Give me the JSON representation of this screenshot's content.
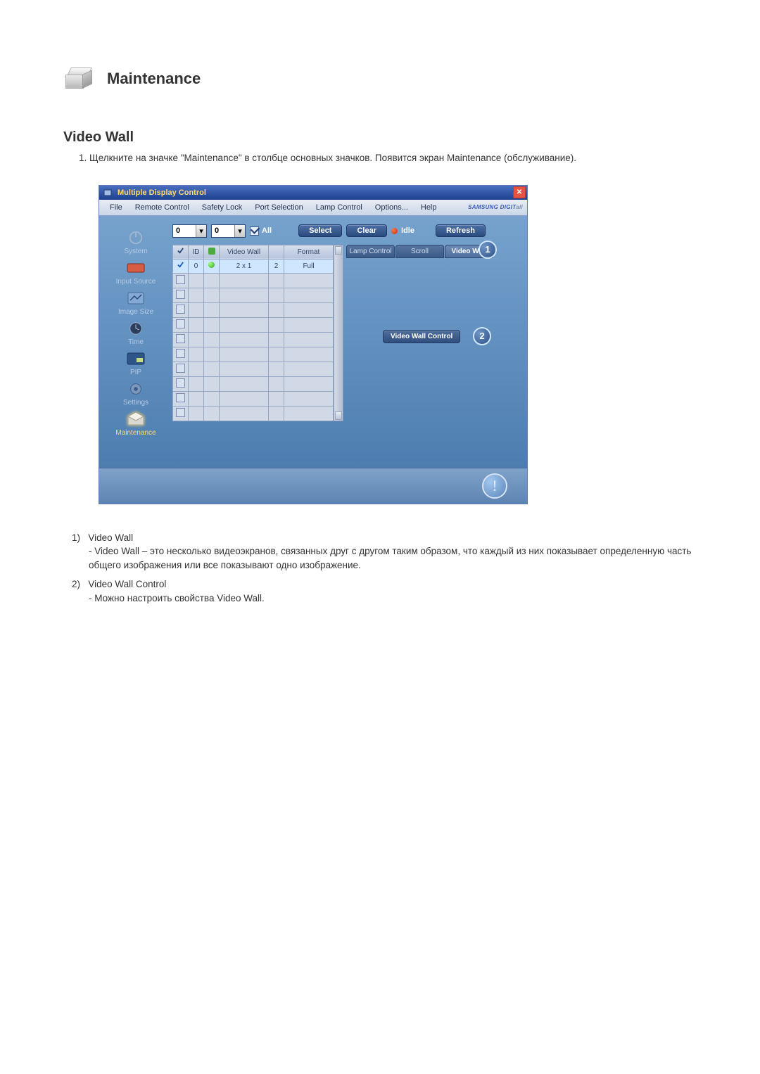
{
  "doc": {
    "heading": "Maintenance",
    "section_title": "Video Wall",
    "intro_item_number": "1.",
    "intro_item_text": "Щелкните на значке \"Maintenance\" в столбце основных значков. Появится экран Maintenance (обслуживание).",
    "explain": {
      "p1_num": "1)",
      "p1_title": "Video Wall",
      "p1_body": "- Video Wall – это несколько видеоэкранов, связанных друг с другом таким образом, что каждый из них показывает определенную часть общего изображения или все показывают одно изображение.",
      "p2_num": "2)",
      "p2_title": "Video Wall Control",
      "p2_body": "- Можно настроить свойства Video Wall."
    }
  },
  "app": {
    "title": "Multiple Display Control",
    "brand": "SAMSUNG DIGIT",
    "brand_suffix": "all",
    "menu": [
      "File",
      "Remote Control",
      "Safety Lock",
      "Port Selection",
      "Lamp Control",
      "Options...",
      "Help"
    ],
    "side": {
      "items": [
        {
          "label": "System"
        },
        {
          "label": "Input Source"
        },
        {
          "label": "Image Size"
        },
        {
          "label": "Time"
        },
        {
          "label": "PIP"
        },
        {
          "label": "Settings"
        },
        {
          "label": "Maintenance"
        }
      ]
    },
    "controls": {
      "num1": "0",
      "num2": "0",
      "all_label": "All",
      "select_label": "Select",
      "clear_label": "Clear",
      "idle_label": "Idle",
      "refresh_label": "Refresh"
    },
    "grid": {
      "headers": {
        "id": "ID",
        "status": "",
        "videowall": "Video Wall",
        "col4": "",
        "format": "Format"
      },
      "row1": {
        "id": "0",
        "videowall": "2 x 1",
        "col4": "2",
        "format": "Full"
      }
    },
    "tabs": {
      "lamp": "Lamp Control",
      "scroll": "Scroll",
      "videowall": "Video Wall"
    },
    "vw_control_btn": "Video Wall Control",
    "callouts": {
      "c1": "1",
      "c2": "2"
    },
    "alert_glyph": "!"
  }
}
